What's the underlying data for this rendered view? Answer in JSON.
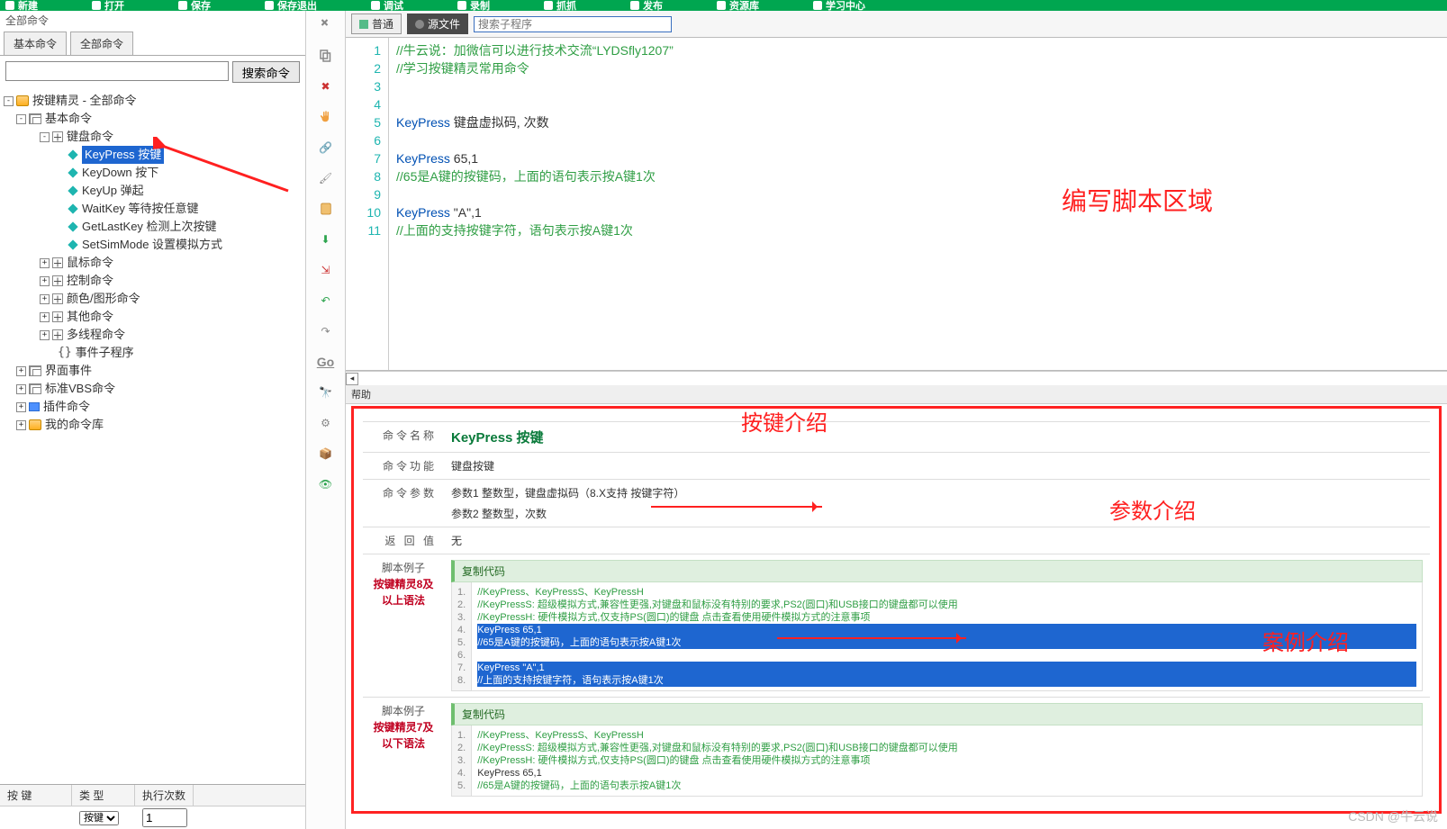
{
  "toolbar": {
    "items": [
      "新建",
      "打开",
      "保存",
      "保存退出",
      "调试",
      "录制",
      "抓抓",
      "发布",
      "资源库",
      "学习中心"
    ]
  },
  "left": {
    "top_label": "全部命令",
    "tabs": [
      "基本命令",
      "全部命令"
    ],
    "search_button": "搜索命令",
    "tree_root": "按键精灵 - 全部命令",
    "basic": "基本命令",
    "keyboard": "键盘命令",
    "kb_items": [
      "KeyPress 按键",
      "KeyDown 按下",
      "KeyUp 弹起",
      "WaitKey 等待按任意键",
      "GetLastKey 检测上次按键",
      "SetSimMode 设置模拟方式"
    ],
    "siblings": [
      "鼠标命令",
      "控制命令",
      "颜色/图形命令",
      "其他命令",
      "多线程命令",
      "事件子程序"
    ],
    "roots2": [
      "界面事件",
      "标准VBS命令",
      "插件命令",
      "我的命令库"
    ],
    "bottom_cols": [
      "按 键",
      "类 型",
      "执行次数"
    ],
    "bottom_type": "按键"
  },
  "docTabs": {
    "t1": "普通",
    "t2": "源文件",
    "search_ph": "搜索子程序"
  },
  "code": {
    "lines": {
      "l1": {
        "cls": "c-comment",
        "txt": "//牛云说：加微信可以进行技术交流“LYDSfly1207”"
      },
      "l2": {
        "cls": "c-comment",
        "txt": "//学习按键精灵常用命令"
      },
      "l3": {
        "cls": "",
        "txt": ""
      },
      "l4": {
        "cls": "",
        "txt": ""
      },
      "l5a": "KeyPress",
      "l5b": " 键盘虚拟码, 次数",
      "l6": "",
      "l7a": "KeyPress",
      "l7b": " 65,1",
      "l8": "//65是A键的按键码，上面的语句表示按A键1次",
      "l9": "",
      "l10a": "KeyPress",
      "l10b": " \"A\",1",
      "l11": "//上面的支持按键字符，语句表示按A键1次"
    },
    "ann": "编写脚本区域"
  },
  "help": {
    "tab": "帮助",
    "cmd_name_k": "命令名称",
    "cmd_name_v": "KeyPress 按键",
    "cmd_func_k": "命令功能",
    "cmd_func_v": "键盘按键",
    "cmd_arg_k": "命令参数",
    "cmd_arg_v1": "参数1 整数型，键盘虚拟码（8.X支持 按键字符）",
    "cmd_arg_v2": "参数2 整数型，次数",
    "ret_k": "返 回 值",
    "ret_v": "无",
    "ex_k": "脚本例子",
    "ex1_t": "按键精灵8及以上语法",
    "ex2_t": "按键精灵7及以下语法",
    "copy": "复制代码",
    "ex1": [
      {
        "c": "cb-cmt",
        "t": "//KeyPress、KeyPressS、KeyPressH"
      },
      {
        "c": "cb-cmt",
        "t": "//KeyPressS: 超级模拟方式,兼容性更强,对键盘和鼠标没有特别的要求,PS2(圆口)和USB接口的键盘都可以使用"
      },
      {
        "c": "cb-cmt",
        "t": "//KeyPressH: 硬件模拟方式,仅支持PS(圆口)的键盘 点击查看使用硬件模拟方式的注意事项"
      },
      {
        "c": "hl",
        "t": "KeyPress 65,1"
      },
      {
        "c": "hl",
        "t": "//65是A键的按键码，上面的语句表示按A键1次"
      },
      {
        "c": "",
        "t": ""
      },
      {
        "c": "hl",
        "t": "KeyPress \"A\",1"
      },
      {
        "c": "hl",
        "t": "//上面的支持按键字符，语句表示按A键1次"
      }
    ],
    "ex2": [
      {
        "c": "cb-cmt",
        "t": "//KeyPress、KeyPressS、KeyPressH"
      },
      {
        "c": "cb-cmt",
        "t": "//KeyPressS: 超级模拟方式,兼容性更强,对键盘和鼠标没有特别的要求,PS2(圆口)和USB接口的键盘都可以使用"
      },
      {
        "c": "cb-cmt",
        "t": "//KeyPressH: 硬件模拟方式,仅支持PS(圆口)的键盘 点击查看使用硬件模拟方式的注意事项"
      },
      {
        "c": "",
        "t": "KeyPress 65,1"
      },
      {
        "c": "cb-cmt",
        "t": "//65是A键的按键码，上面的语句表示按A键1次"
      }
    ],
    "ann_intro": "按键介绍",
    "ann_param": "参数介绍",
    "ann_case": "案例介绍"
  },
  "watermark": "CSDN @牛云说"
}
